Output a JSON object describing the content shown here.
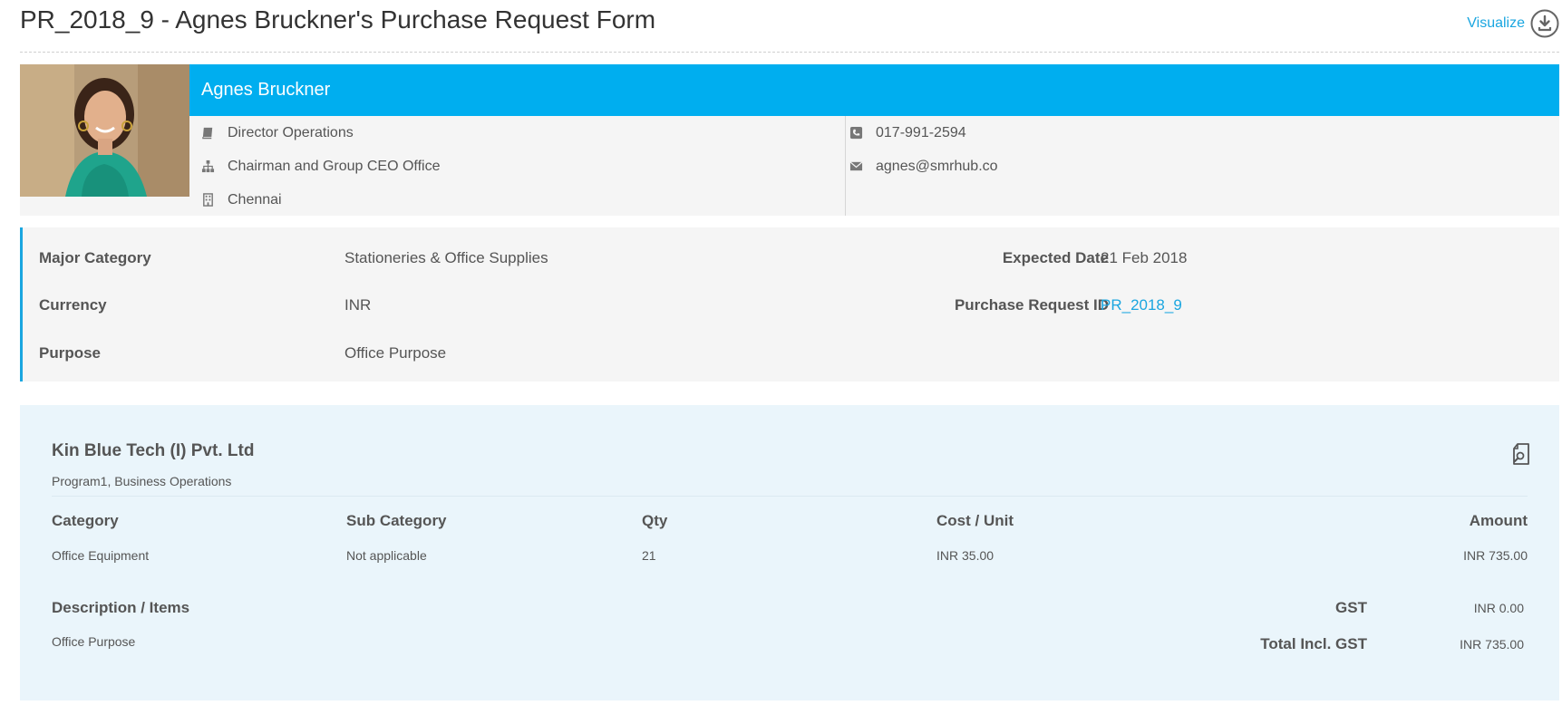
{
  "header": {
    "title": "PR_2018_9 - Agnes Bruckner's Purchase Request Form",
    "visualize_label": "Visualize",
    "visualize_icon": "download-circle-icon"
  },
  "profile": {
    "name": "Agnes Bruckner",
    "designation": "Director Operations",
    "department": "Chairman and Group CEO Office",
    "location": "Chennai",
    "phone": "017-991-2594",
    "email": "agnes@smrhub.co",
    "accent_color": "#00aeef"
  },
  "details": {
    "major_category_label": "Major Category",
    "major_category_value": "Stationeries & Office Supplies",
    "currency_label": "Currency",
    "currency_value": "INR",
    "purpose_label": "Purpose",
    "purpose_value": "Office Purpose",
    "expected_date_label": "Expected Date",
    "expected_date_value": "21 Feb 2018",
    "pr_id_label": "Purchase Request ID",
    "pr_id_value": "PR_2018_9"
  },
  "vendor": {
    "name": "Kin Blue Tech (I) Pvt. Ltd",
    "subtitle": "Program1, Business Operations",
    "edit_icon": "document-search-icon",
    "columns": {
      "category": "Category",
      "sub_category": "Sub Category",
      "qty": "Qty",
      "cost_unit": "Cost / Unit",
      "amount": "Amount"
    },
    "item": {
      "category": "Office Equipment",
      "sub_category": "Not applicable",
      "qty": "21",
      "cost_unit": "INR 35.00",
      "amount": "INR 735.00"
    },
    "description_label": "Description / Items",
    "description_value": "Office Purpose",
    "gst_label": "GST",
    "gst_value": "INR 0.00",
    "total_label": "Total Incl. GST",
    "total_value": "INR 735.00"
  }
}
